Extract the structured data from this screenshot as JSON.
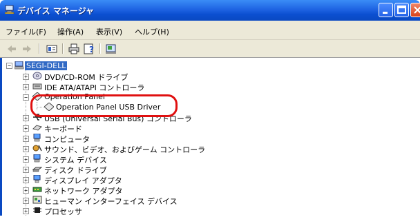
{
  "window": {
    "title": "デバイス マネージャ",
    "controls": [
      "minimize-icon",
      "maximize-icon",
      "close-icon"
    ]
  },
  "menu": [
    {
      "label": "ファイル(F)"
    },
    {
      "label": "操作(A)"
    },
    {
      "label": "表示(V)"
    },
    {
      "label": "ヘルプ(H)"
    }
  ],
  "toolbar": [
    "back-arrow-icon",
    "forward-arrow-icon",
    "properties-icon",
    "print-icon",
    "help-icon",
    "scan-hardware-icon"
  ],
  "tree": {
    "root": "SEGI-DELL",
    "items": [
      {
        "label": "DVD/CD-ROM ドライブ",
        "icon": "cdrom-icon"
      },
      {
        "label": "IDE ATA/ATAPI コントローラ",
        "icon": "ide-controller-icon"
      },
      {
        "label": "Operation Panel",
        "icon": "diamond-icon",
        "expanded": true,
        "children": [
          {
            "label": "Operation Panel USB Driver",
            "icon": "diamond-icon"
          }
        ]
      },
      {
        "label": "USB (Universal Serial Bus) コントローラ",
        "icon": "usb-icon"
      },
      {
        "label": "キーボード",
        "icon": "keyboard-icon"
      },
      {
        "label": "コンピュータ",
        "icon": "computer-icon"
      },
      {
        "label": "サウンド、ビデオ、およびゲーム コントローラ",
        "icon": "sound-icon"
      },
      {
        "label": "システム デバイス",
        "icon": "system-device-icon"
      },
      {
        "label": "ディスク ドライブ",
        "icon": "disk-drive-icon"
      },
      {
        "label": "ディスプレイ アダプタ",
        "icon": "display-adapter-icon"
      },
      {
        "label": "ネットワーク アダプタ",
        "icon": "network-adapter-icon"
      },
      {
        "label": "ヒューマン インターフェイス デバイス",
        "icon": "hid-icon"
      },
      {
        "label": "プロセッサ",
        "icon": "processor-icon"
      }
    ]
  },
  "colors": {
    "titlebar": "#0a49c2",
    "highlight": "#e01010",
    "selection": "#316ac5",
    "chrome": "#ece9d8"
  }
}
